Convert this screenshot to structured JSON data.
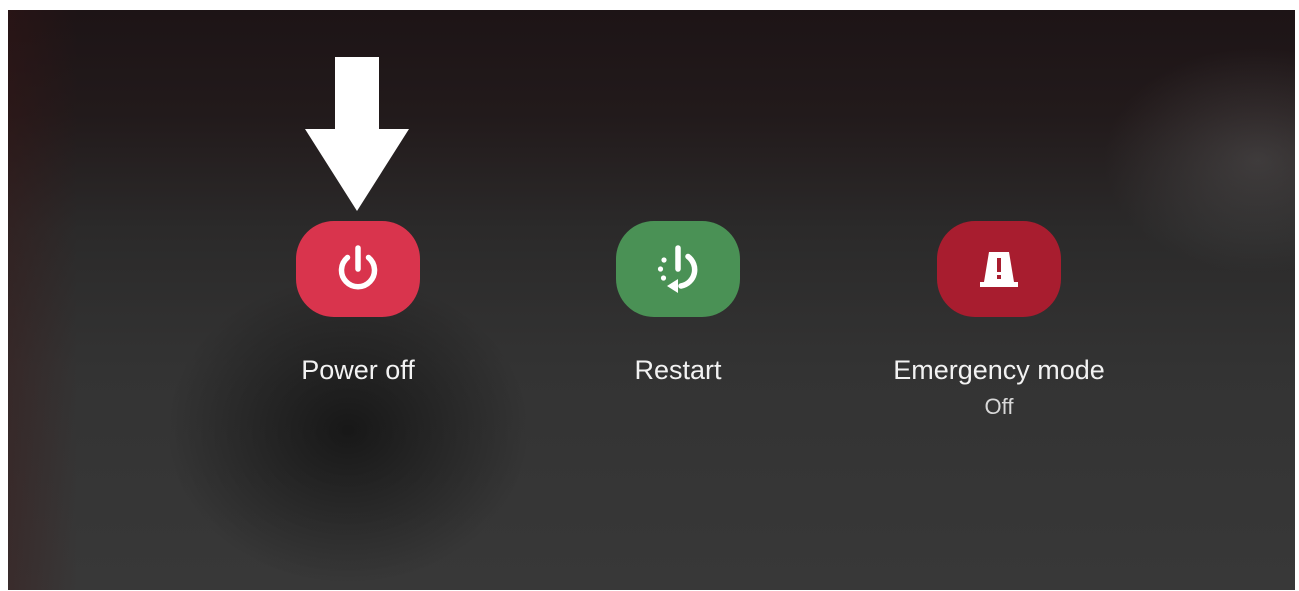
{
  "power_menu": {
    "power_off": {
      "label": "Power off",
      "icon": "power-icon",
      "color": "#d9344d"
    },
    "restart": {
      "label": "Restart",
      "icon": "restart-icon",
      "color": "#4a9155"
    },
    "emergency_mode": {
      "label": "Emergency mode",
      "status": "Off",
      "icon": "emergency-light-icon",
      "color": "#a81d2f"
    }
  },
  "annotation": {
    "icon": "down-arrow-icon",
    "color": "#ffffff"
  }
}
